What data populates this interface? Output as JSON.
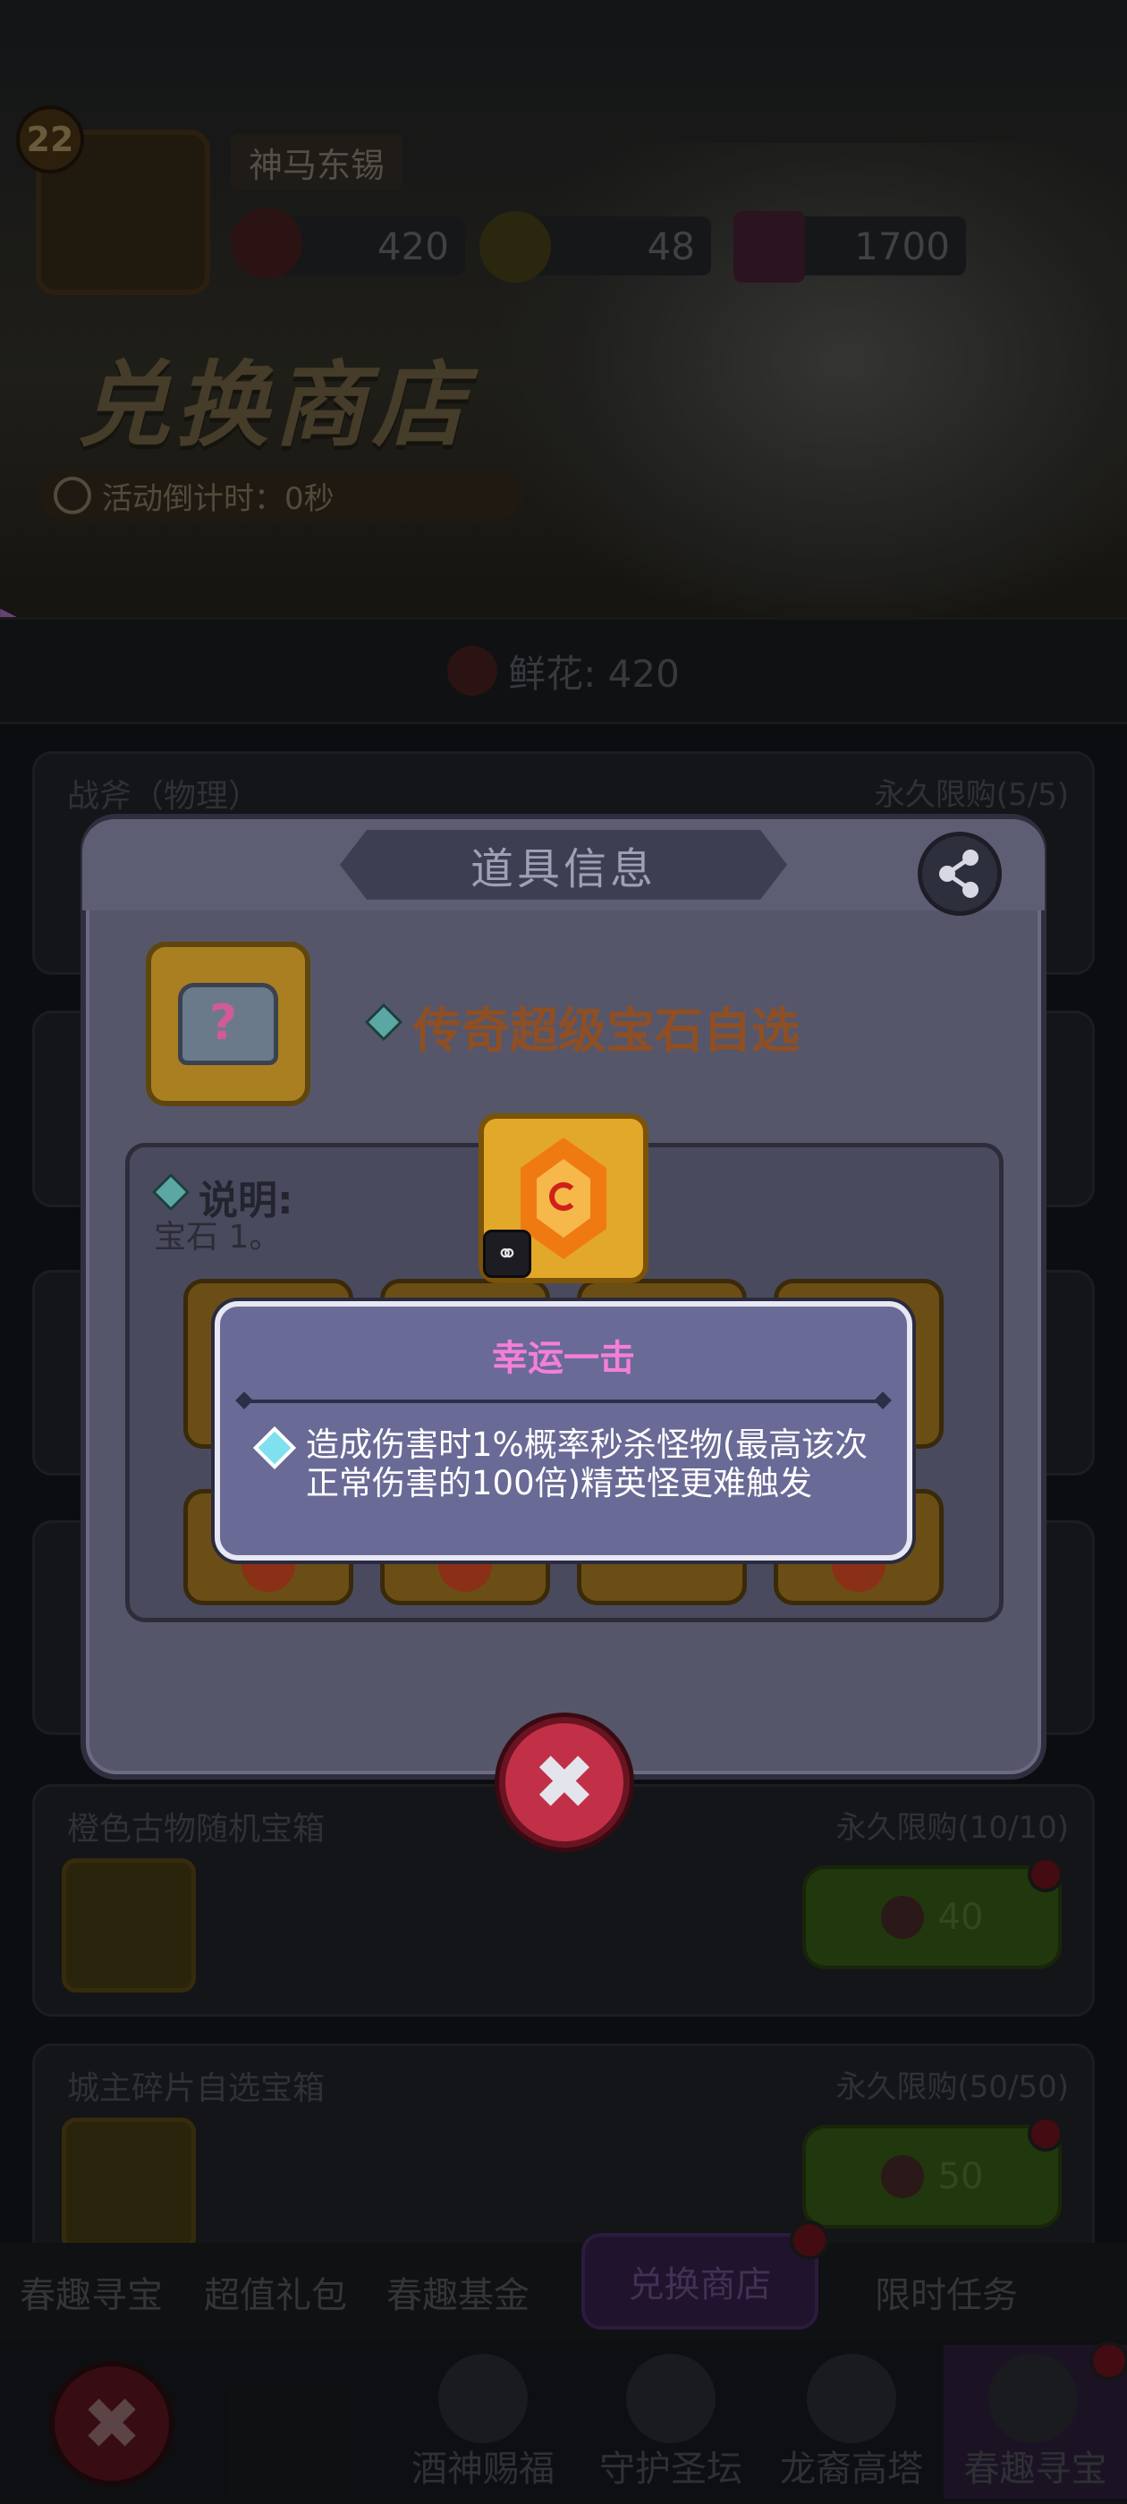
{
  "player": {
    "level": "22",
    "name": "神马东锡",
    "flowers": "420",
    "coins": "48",
    "gems": "1700"
  },
  "shop": {
    "title": "兑换商店",
    "countdown": "活动倒计时：0秒",
    "flower_balance": "鲜花: 420"
  },
  "cards": [
    {
      "title": "战斧（物理）",
      "limit": "永久限购(5/5)"
    },
    {
      "title": "橙色古物随机宝箱",
      "limit": "永久限购(10/10)",
      "price": "40"
    },
    {
      "title": "城主碎片自选宝箱",
      "limit": "永久限购(50/50)",
      "price": "50"
    }
  ],
  "tabs": [
    "春趣寻宝",
    "超值礼包",
    "春趣基金",
    "兑换商店",
    "限时任务"
  ],
  "bottom_nav": [
    "酒神赐福",
    "守护圣坛",
    "龙裔高塔",
    "春趣寻宝"
  ],
  "modal": {
    "title": "道具信息",
    "item_name": "传奇超级宝石自选",
    "desc_label": "说明:",
    "desc_fragment": "宝石 1。"
  },
  "tooltip": {
    "title": "幸运一击",
    "text": "造成伤害时1%概率秒杀怪物(最高该次正常伤害的100倍)精英怪更难触发"
  },
  "colors": {
    "tooltip_title": "#f47fd8",
    "item_name": "#8e4f24",
    "close_button": "#c23048"
  }
}
